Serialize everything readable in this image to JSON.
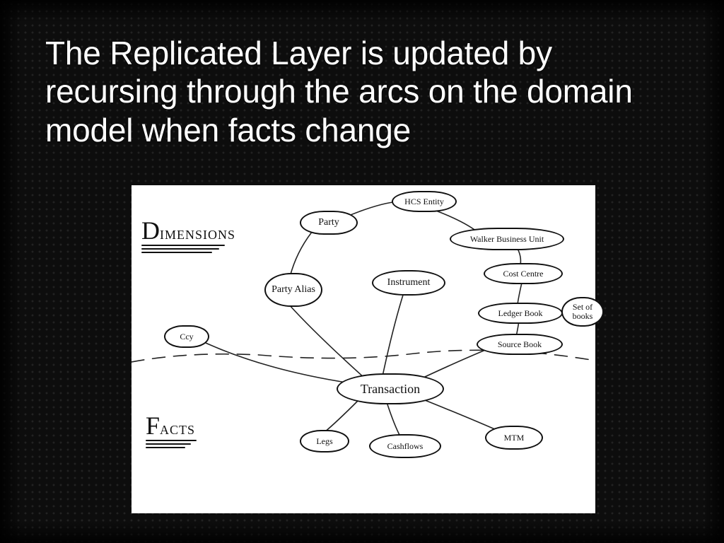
{
  "title": "The Replicated Layer is updated by recursing through the arcs on the domain model when facts change",
  "sections": {
    "dimensions": {
      "initial": "D",
      "rest": "IMENSIONS"
    },
    "facts": {
      "initial": "F",
      "rest": "ACTS"
    }
  },
  "nodes": {
    "party": "Party",
    "party_alias": "Party Alias",
    "ccy": "Ccy",
    "hcs_entity": "HCS Entity",
    "walker_bu": "Walker Business Unit",
    "cost_centre": "Cost Centre",
    "ledger_book": "Ledger Book",
    "set_of_books": "Set of books",
    "source_book": "Source Book",
    "instrument": "Instrument",
    "transaction": "Transaction",
    "legs": "Legs",
    "cashflows": "Cashflows",
    "mtm": "MTM"
  },
  "diagram": {
    "regions": [
      "Dimensions",
      "Facts"
    ],
    "facts_center": "Transaction",
    "transaction_children": [
      "Legs",
      "Cashflows",
      "MTM"
    ],
    "transaction_dimensions": [
      "Ccy",
      "Party Alias",
      "Instrument",
      "Source Book"
    ],
    "dimension_links": [
      [
        "Party Alias",
        "Party"
      ],
      [
        "Party",
        "HCS Entity"
      ],
      [
        "HCS Entity",
        "Walker Business Unit"
      ],
      [
        "Walker Business Unit",
        "Cost Centre"
      ],
      [
        "Cost Centre",
        "Ledger Book"
      ],
      [
        "Ledger Book",
        "Set of books"
      ],
      [
        "Ledger Book",
        "Source Book"
      ]
    ]
  }
}
